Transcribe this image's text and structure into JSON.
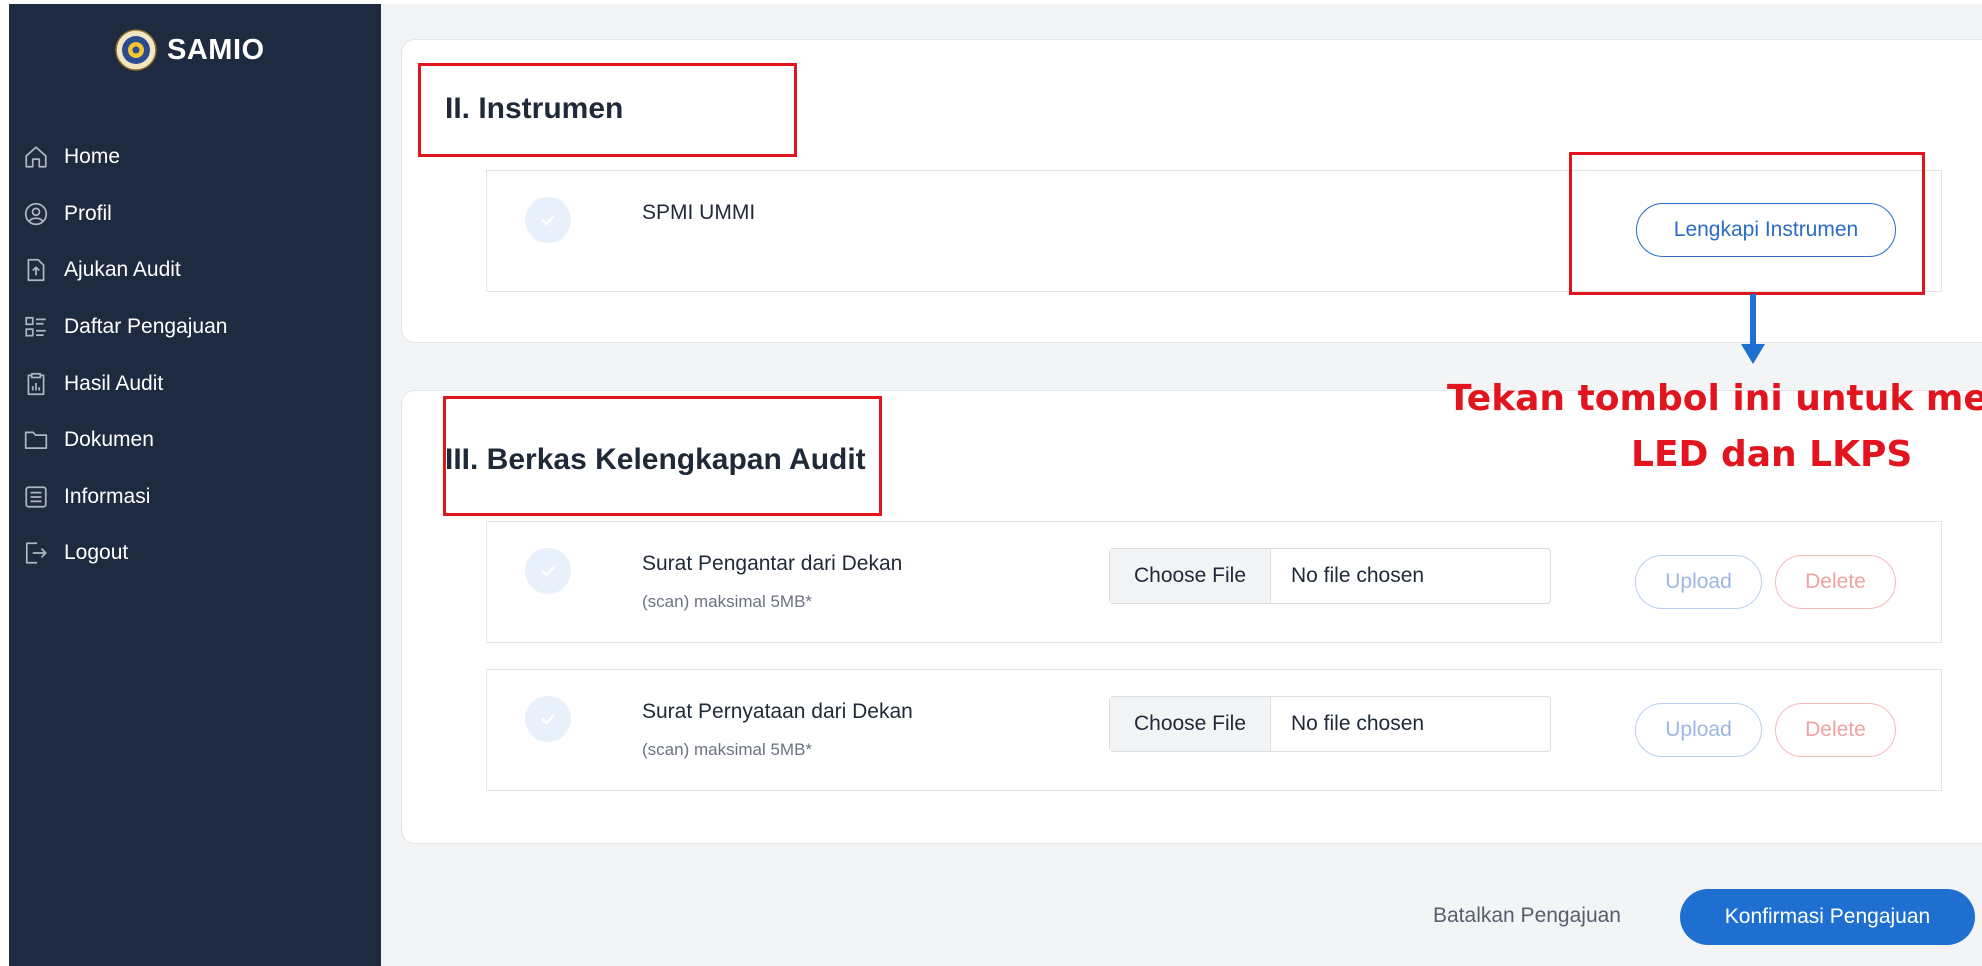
{
  "app": {
    "name": "SAMIO"
  },
  "sidebar": {
    "items": [
      {
        "label": "Home",
        "icon": "home-icon"
      },
      {
        "label": "Profil",
        "icon": "user-circle-icon"
      },
      {
        "label": "Ajukan Audit",
        "icon": "file-upload-icon"
      },
      {
        "label": "Daftar Pengajuan",
        "icon": "list-icon"
      },
      {
        "label": "Hasil Audit",
        "icon": "clipboard-chart-icon"
      },
      {
        "label": "Dokumen",
        "icon": "folder-icon"
      },
      {
        "label": "Informasi",
        "icon": "document-lines-icon"
      },
      {
        "label": "Logout",
        "icon": "logout-icon"
      }
    ]
  },
  "instrumen": {
    "title": "II. Instrumen",
    "item_name": "SPMI UMMI",
    "button_label": "Lengkapi Instrumen"
  },
  "annotation": {
    "line1": "Tekan tombol ini untuk me",
    "line2": "LED dan LKPS",
    "color": "#e2141d",
    "arrow_color": "#1e6fd0"
  },
  "berkas": {
    "title": "III. Berkas Kelengkapan Audit",
    "rows": [
      {
        "title": "Surat Pengantar dari Dekan",
        "subtitle": "(scan) maksimal 5MB*",
        "choose_label": "Choose File",
        "file_status": "No file chosen",
        "upload_label": "Upload",
        "delete_label": "Delete"
      },
      {
        "title": "Surat Pernyataan dari Dekan",
        "subtitle": "(scan) maksimal 5MB*",
        "choose_label": "Choose File",
        "file_status": "No file chosen",
        "upload_label": "Upload",
        "delete_label": "Delete"
      }
    ]
  },
  "footer": {
    "cancel_label": "Batalkan Pengajuan",
    "confirm_label": "Konfirmasi Pengajuan"
  },
  "colors": {
    "sidebar_bg": "#1e2a3f",
    "accent": "#1e6fd0",
    "highlight_red": "#e2141d"
  }
}
